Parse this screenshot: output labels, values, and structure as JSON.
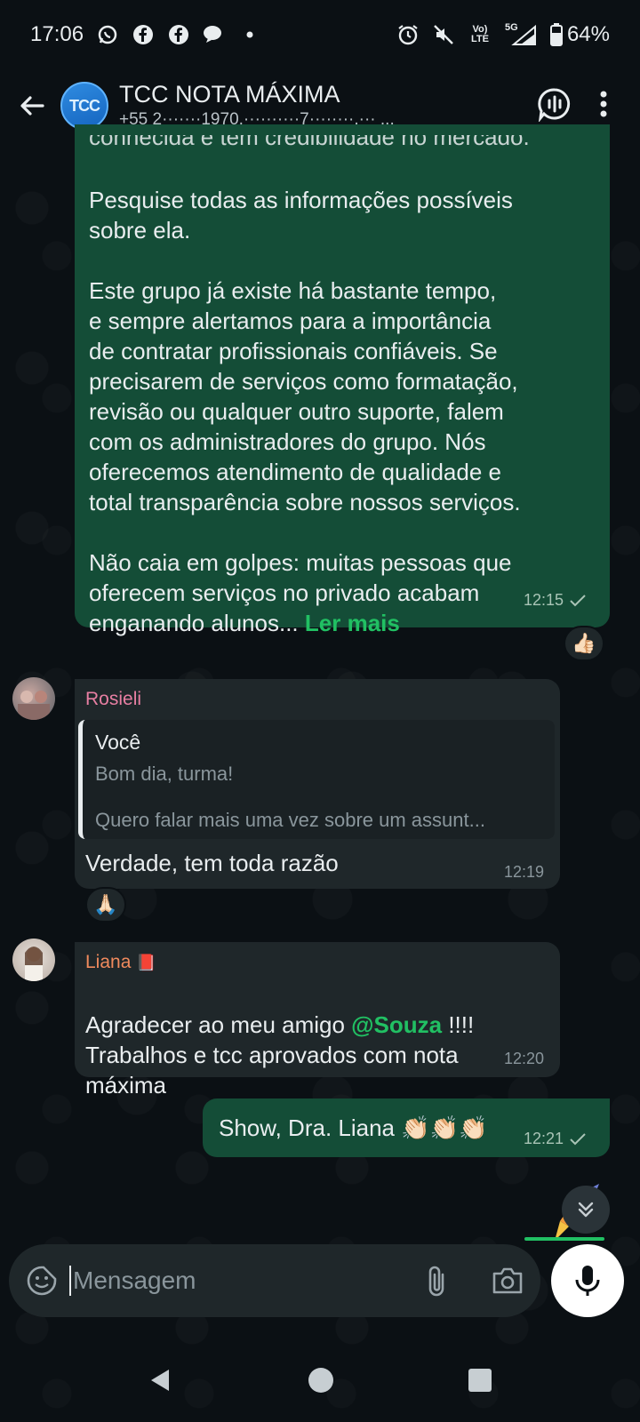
{
  "status_bar": {
    "time": "17:06",
    "battery": "64%",
    "net_top": "Vo)",
    "net_bottom": "LTE",
    "net_5g": "5G"
  },
  "header": {
    "avatar_text": "TCC",
    "title": "TCC NOTA MÁXIMA",
    "subtitle": "+55 2·······1970,··········7········,··· ..."
  },
  "messages": {
    "m1": {
      "cut_top": "conhecida e tem credibilidade no mercado.",
      "text": "Pesquise todas as informações possíveis\nsobre ela.\n\nEste grupo já existe há bastante tempo,\ne sempre alertamos para a importância\nde contratar profissionais confiáveis. Se\nprecisarem de serviços como formatação,\nrevisão ou qualquer outro suporte, falem\ncom os administradores do grupo. Nós\noferecemos atendimento de qualidade e\ntotal transparência sobre nossos serviços.\n\nNão caia em golpes: muitas pessoas que\noferecem serviços no privado acabam\nenganando alunos...",
      "read_more": "Ler mais",
      "time": "12:15",
      "reaction": "👍🏻"
    },
    "m2": {
      "sender": "Rosieli",
      "quote_author": "Você",
      "quote_line1": "Bom dia, turma!",
      "quote_line2": "Quero falar mais uma vez sobre um assunt...",
      "text": "Verdade, tem toda razão",
      "time": "12:19",
      "reaction": "🙏🏻"
    },
    "m3": {
      "sender": "Liana",
      "sender_emoji": "📕",
      "text_before": "Agradecer ao meu amigo ",
      "mention": "@Souza",
      "text_after": " !!!!\nTrabalhos e tcc aprovados com nota\nmáxima",
      "time": "12:20"
    },
    "m4": {
      "text": "Show, Dra. Liana 👏🏻👏🏻👏🏻",
      "time": "12:21"
    }
  },
  "input": {
    "placeholder": "Mensagem"
  },
  "colors": {
    "outgoing_bubble": "#144d37",
    "incoming_bubble": "#1f272a",
    "accent_green": "#21c063",
    "rosieli_name": "#e87fa3",
    "liana_name": "#f08a5d"
  }
}
